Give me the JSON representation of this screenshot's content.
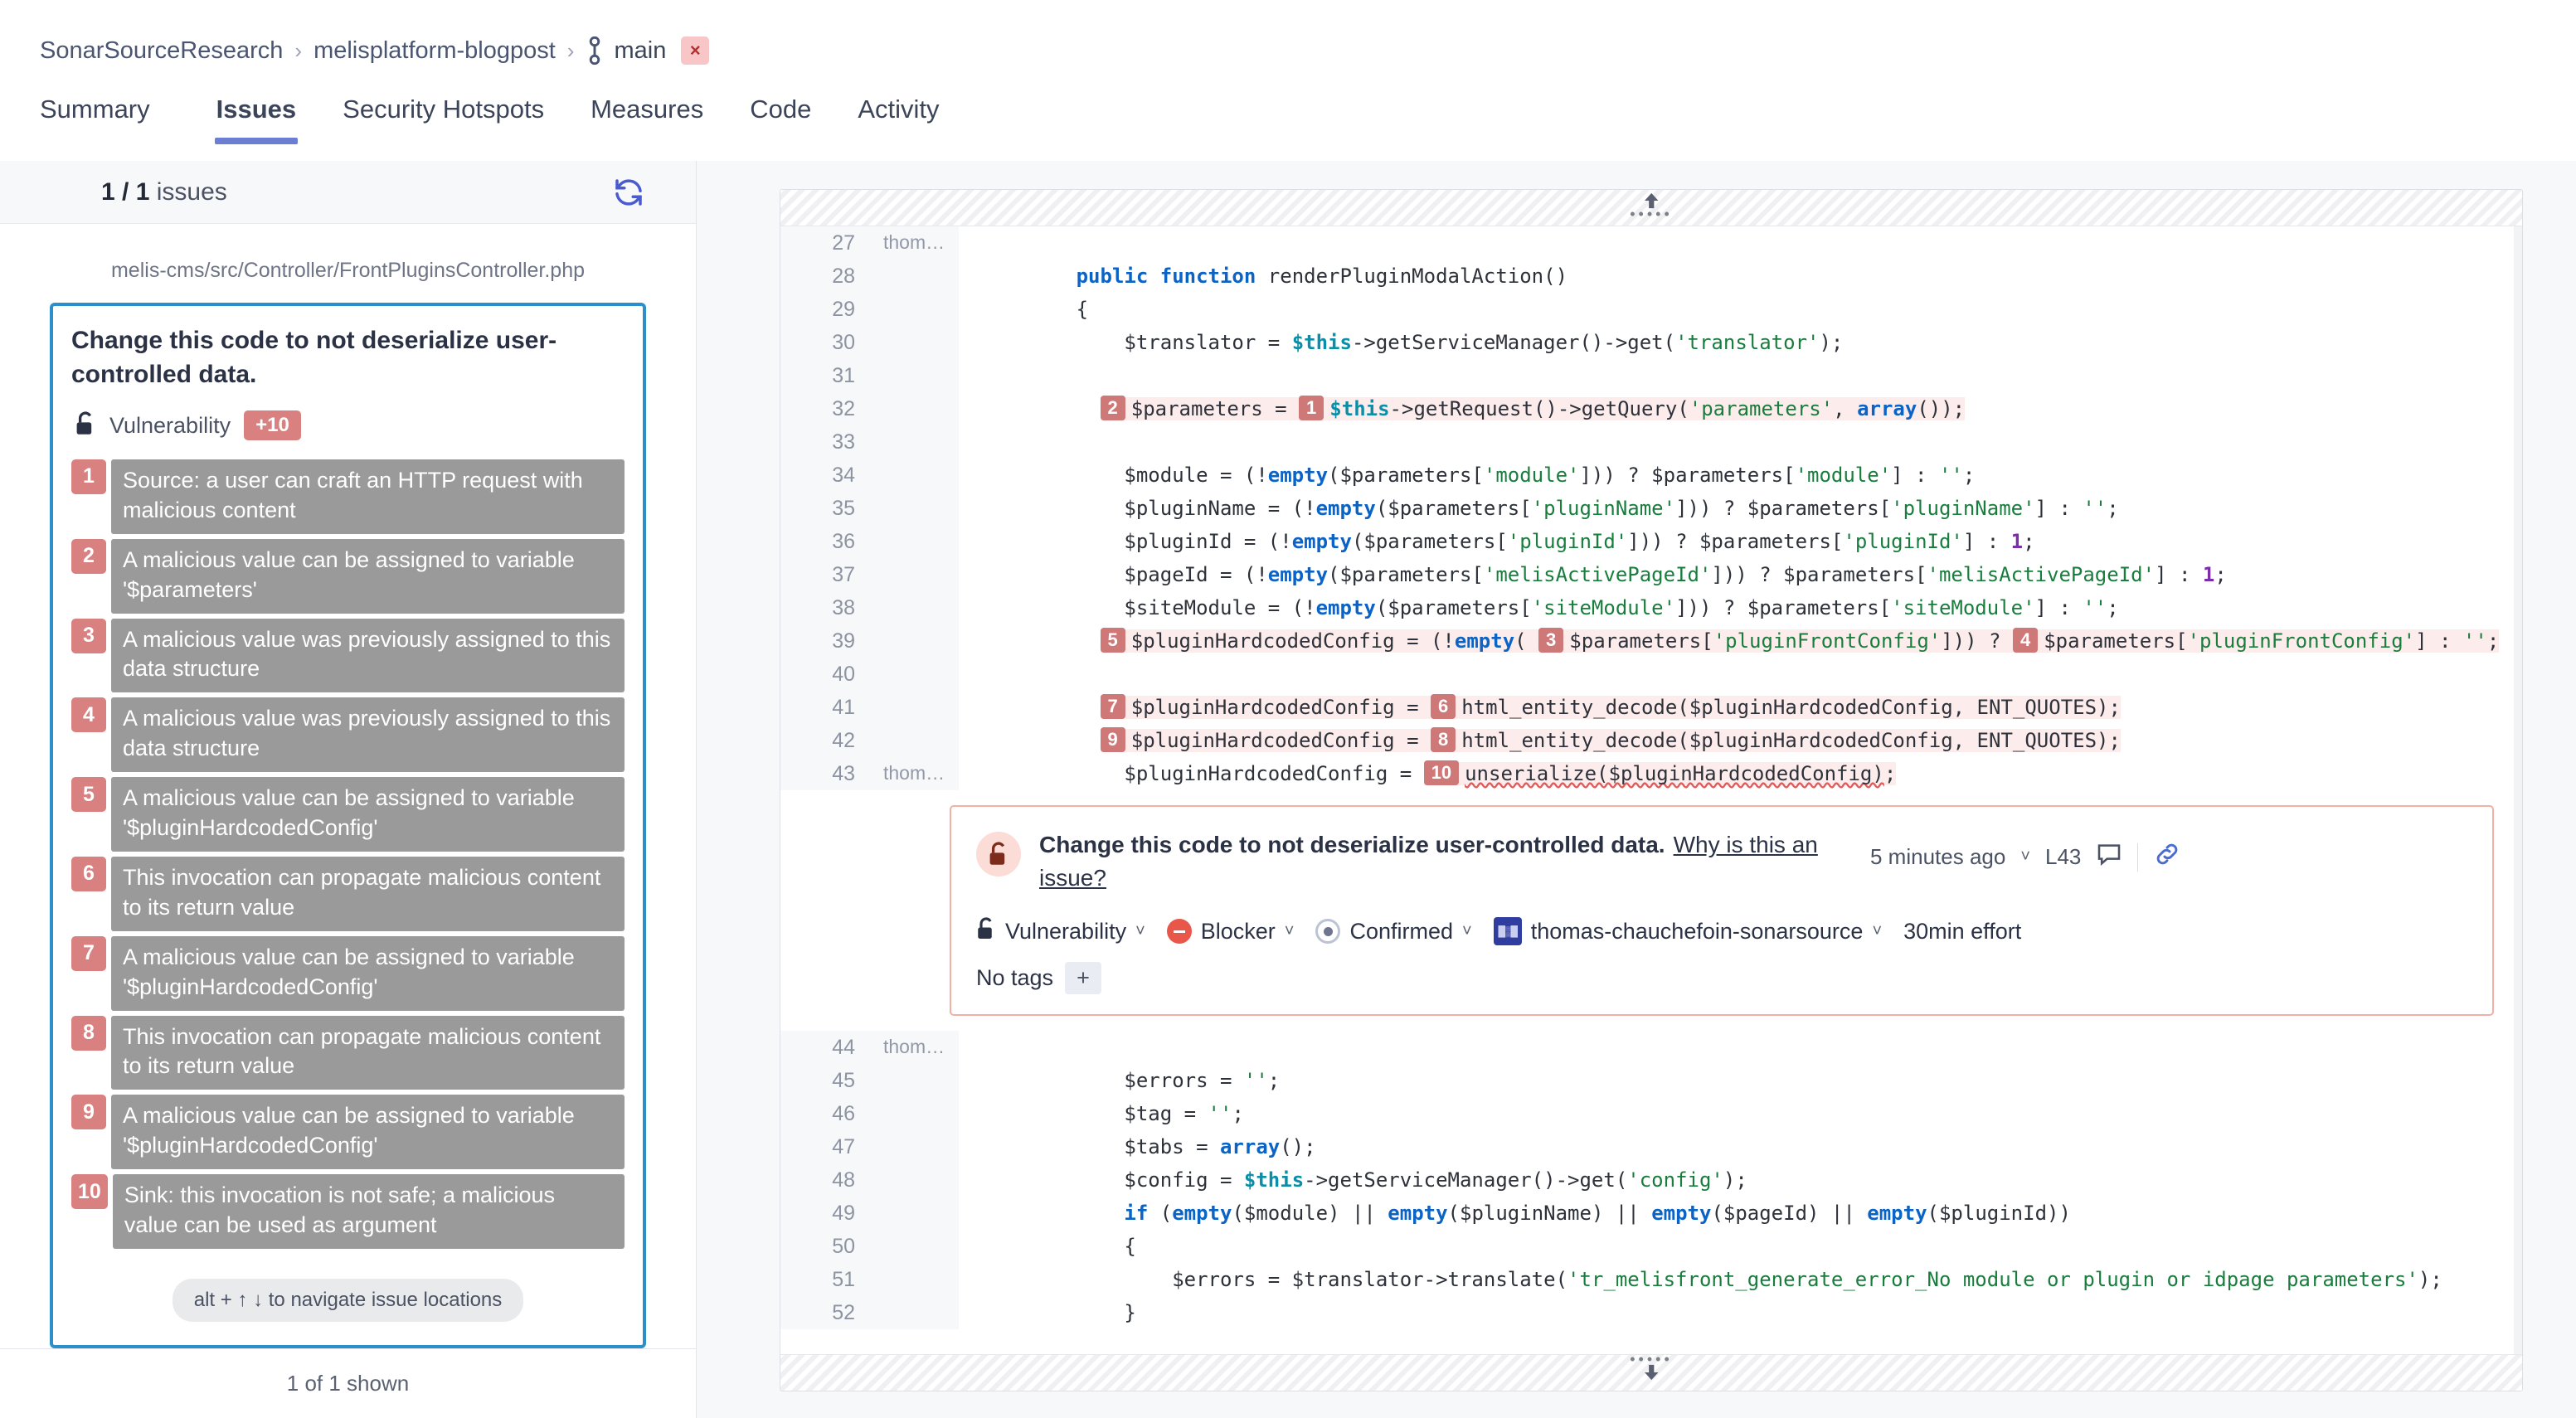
{
  "breadcrumb": {
    "org": "SonarSourceResearch",
    "project": "melisplatform-blogpost",
    "branch": "main",
    "separator": "›",
    "close_label": "×"
  },
  "tabs": [
    {
      "label": "Summary",
      "active": false
    },
    {
      "label": "Issues",
      "active": true
    },
    {
      "label": "Security Hotspots",
      "active": false
    },
    {
      "label": "Measures",
      "active": false
    },
    {
      "label": "Code",
      "active": false
    },
    {
      "label": "Activity",
      "active": false
    }
  ],
  "sidebar": {
    "count_current": "1 / 1",
    "count_label": "issues",
    "refresh_icon": "refresh-icon",
    "file_path": "melis-cms/src/Controller/FrontPluginsController.php",
    "issue": {
      "title": "Change this code to not deserialize user-controlled data.",
      "type_icon": "unlock-icon",
      "type_label": "Vulnerability",
      "effort_badge": "+10"
    },
    "flow_locations": [
      {
        "index": "1",
        "text": "Source: a user can craft an HTTP request with malicious content"
      },
      {
        "index": "2",
        "text": "A malicious value can be assigned to variable '$parameters'"
      },
      {
        "index": "3",
        "text": "A malicious value was previously assigned to this data structure"
      },
      {
        "index": "4",
        "text": "A malicious value was previously assigned to this data structure"
      },
      {
        "index": "5",
        "text": "A malicious value can be assigned to variable '$pluginHardcodedConfig'"
      },
      {
        "index": "6",
        "text": "This invocation can propagate malicious content to its return value"
      },
      {
        "index": "7",
        "text": "A malicious value can be assigned to variable '$pluginHardcodedConfig'"
      },
      {
        "index": "8",
        "text": "This invocation can propagate malicious content to its return value"
      },
      {
        "index": "9",
        "text": "A malicious value can be assigned to variable '$pluginHardcodedConfig'"
      },
      {
        "index": "10",
        "text": "Sink: this invocation is not safe; a malicious value can be used as argument"
      }
    ],
    "nav_hint": "alt + ↑ ↓ to navigate issue locations",
    "footer": "1 of 1 shown"
  },
  "code_panel": {
    "expand_up_icon": "expand-up-icon",
    "expand_down_icon": "expand-down-icon",
    "scm_author_short": "thom…",
    "lines_top": [
      {
        "num": "27",
        "scm": "thom…",
        "code": ""
      },
      {
        "num": "28",
        "scm": "",
        "code": "        public function renderPluginModalAction()"
      },
      {
        "num": "29",
        "scm": "",
        "code": "        {"
      },
      {
        "num": "30",
        "scm": "",
        "code": "            $translator = $this->getServiceManager()->get('translator');"
      },
      {
        "num": "31",
        "scm": "",
        "code": ""
      },
      {
        "num": "32",
        "scm": "",
        "code": "            $parameters = $this->getRequest()->getQuery('parameters', array());"
      },
      {
        "num": "33",
        "scm": "",
        "code": ""
      },
      {
        "num": "34",
        "scm": "",
        "code": "            $module = (!empty($parameters['module'])) ? $parameters['module'] : '';"
      },
      {
        "num": "35",
        "scm": "",
        "code": "            $pluginName = (!empty($parameters['pluginName'])) ? $parameters['pluginName'] : '';"
      },
      {
        "num": "36",
        "scm": "",
        "code": "            $pluginId = (!empty($parameters['pluginId'])) ? $parameters['pluginId'] : 1;"
      },
      {
        "num": "37",
        "scm": "",
        "code": "            $pageId = (!empty($parameters['melisActivePageId'])) ? $parameters['melisActivePageId'] : 1;"
      },
      {
        "num": "38",
        "scm": "",
        "code": "            $siteModule = (!empty($parameters['siteModule'])) ? $parameters['siteModule'] : '';"
      },
      {
        "num": "39",
        "scm": "",
        "code": "            $pluginHardcodedConfig = (!empty($parameters['pluginFrontConfig'])) ? $parameters['pluginFrontConfig'] : '';"
      },
      {
        "num": "40",
        "scm": "",
        "code": ""
      },
      {
        "num": "41",
        "scm": "",
        "code": "            $pluginHardcodedConfig = html_entity_decode($pluginHardcodedConfig, ENT_QUOTES);"
      },
      {
        "num": "42",
        "scm": "",
        "code": "            $pluginHardcodedConfig = html_entity_decode($pluginHardcodedConfig, ENT_QUOTES);"
      },
      {
        "num": "43",
        "scm": "thom…",
        "code": "            $pluginHardcodedConfig = unserialize($pluginHardcodedConfig);"
      }
    ],
    "lines_bottom": [
      {
        "num": "44",
        "scm": "thom…",
        "code": ""
      },
      {
        "num": "45",
        "scm": "",
        "code": "            $errors = '';"
      },
      {
        "num": "46",
        "scm": "",
        "code": "            $tag = '';"
      },
      {
        "num": "47",
        "scm": "",
        "code": "            $tabs = array();"
      },
      {
        "num": "48",
        "scm": "",
        "code": "            $config = $this->getServiceManager()->get('config');"
      },
      {
        "num": "49",
        "scm": "",
        "code": "            if (empty($module) || empty($pluginName) || empty($pageId) || empty($pluginId))"
      },
      {
        "num": "50",
        "scm": "",
        "code": "            {"
      },
      {
        "num": "51",
        "scm": "",
        "code": "                $errors = $translator->translate('tr_melisfront_generate_error_No module or plugin or idpage parameters');"
      },
      {
        "num": "52",
        "scm": "",
        "code": "            }"
      }
    ]
  },
  "detail_card": {
    "icon": "unlock-icon",
    "message": "Change this code to not deserialize user-controlled data.",
    "why_link": "Why is this an issue?",
    "timestamp": "5 minutes ago",
    "line_ref": "L43",
    "comment_icon": "comment-icon",
    "link_icon": "link-icon",
    "attributes": {
      "type": "Vulnerability",
      "severity": "Blocker",
      "status": "Confirmed",
      "assignee": "thomas-chauchefoin-sonarsource",
      "effort": "30min effort"
    },
    "tags_label": "No tags",
    "tags_add": "+"
  }
}
